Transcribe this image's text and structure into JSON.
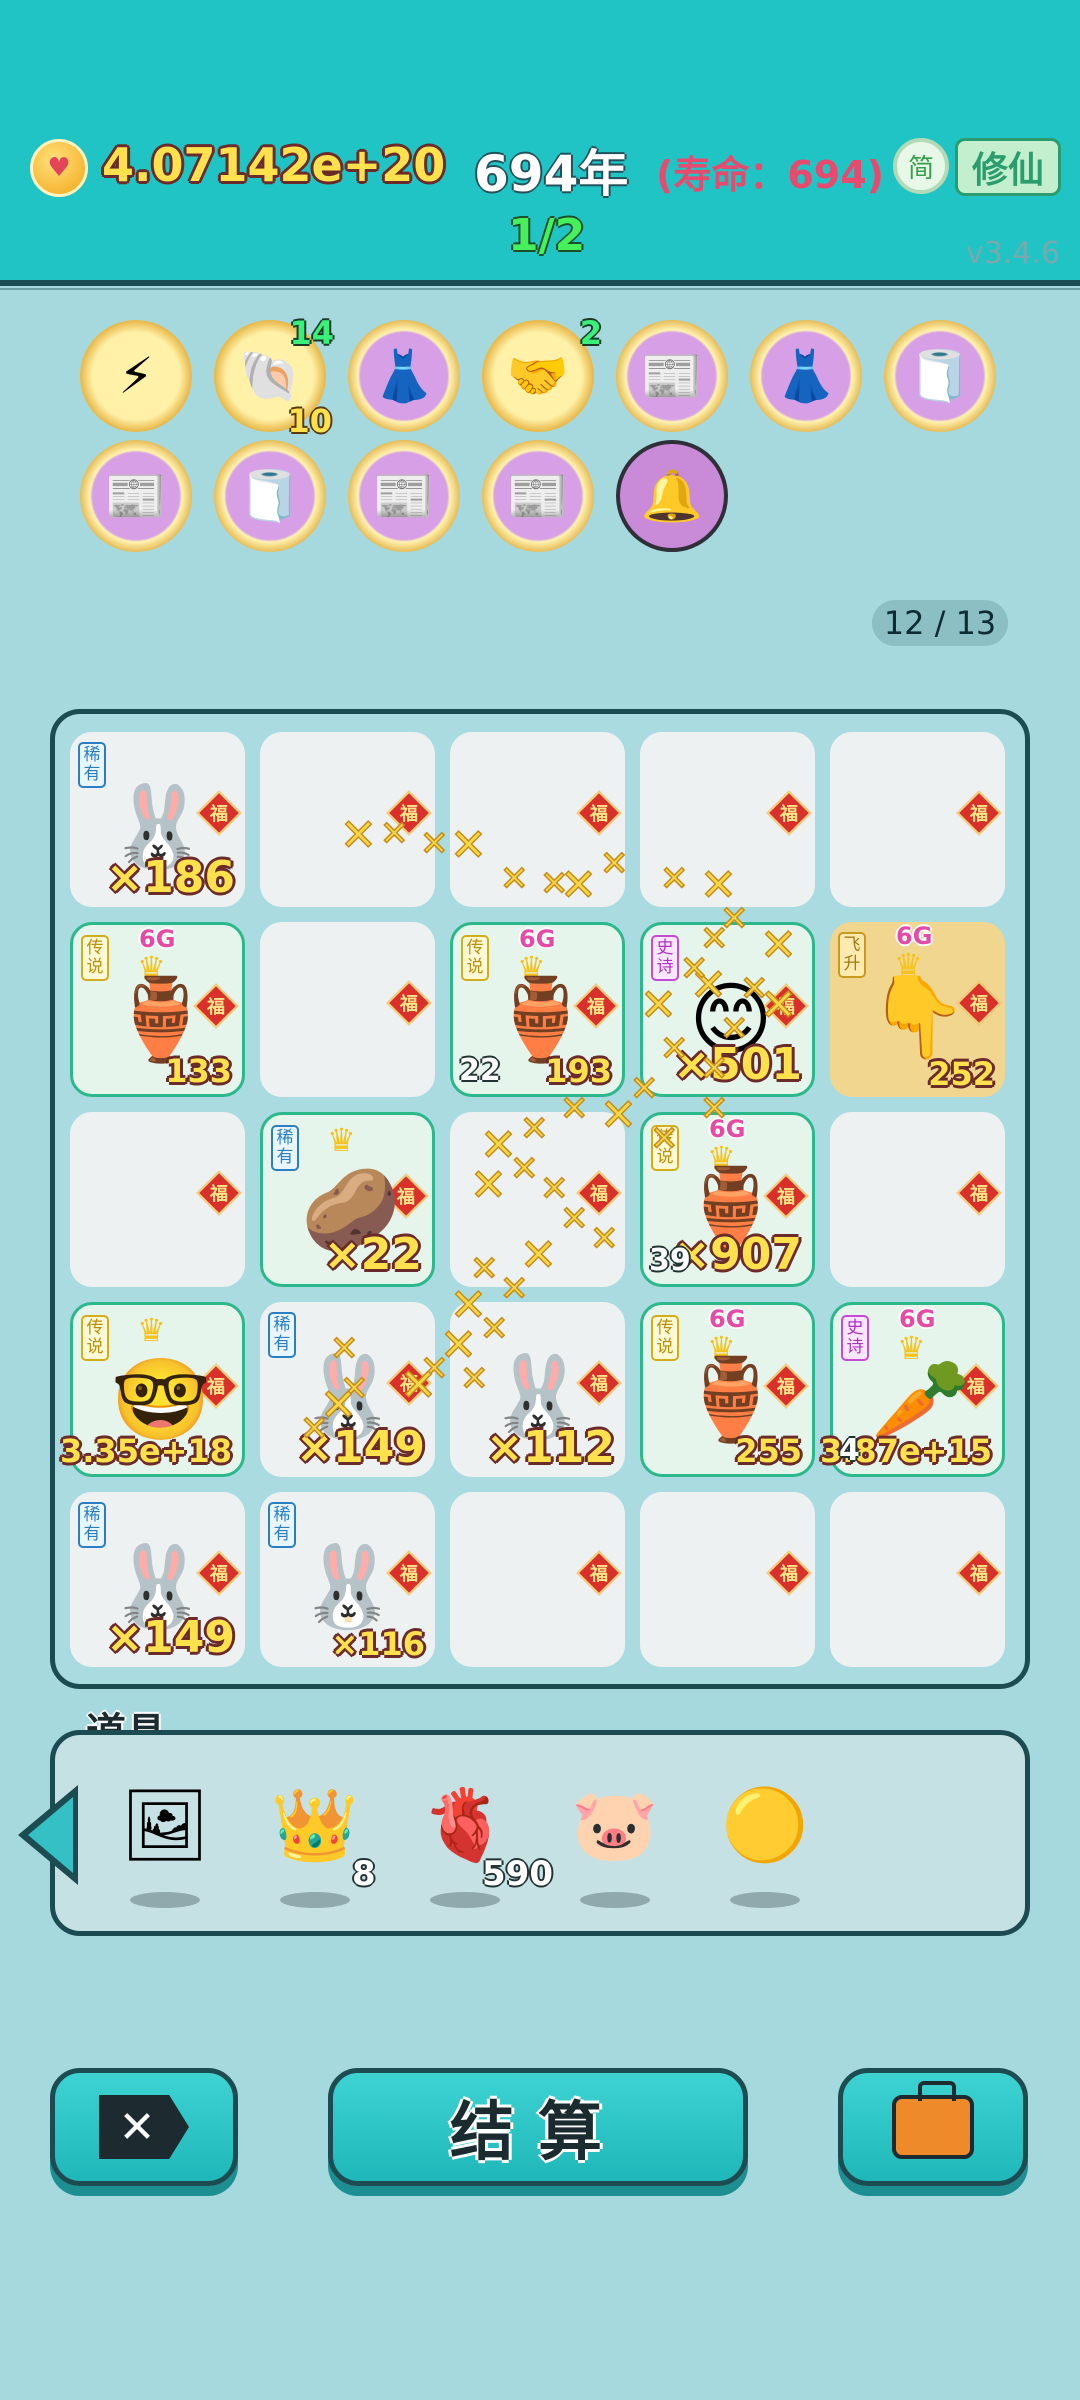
{
  "header": {
    "coins": "4.07142e+20",
    "year": "694年",
    "lifespan": "(寿命：694)",
    "round": "1/2",
    "lang_button": "简",
    "mode_button": "修仙",
    "version": "v3.4.6"
  },
  "relics": [
    {
      "icon": "lightning-icon",
      "glyph": "⚡",
      "style": "gold",
      "badge": ""
    },
    {
      "icon": "shell-icon",
      "glyph": "🐚",
      "style": "gold",
      "badge": "14",
      "badge2": "10"
    },
    {
      "icon": "skirt-icon",
      "glyph": "👗",
      "style": "pink",
      "badge": ""
    },
    {
      "icon": "handshake-icon",
      "glyph": "🤝",
      "style": "gold",
      "badge": "2"
    },
    {
      "icon": "time-magazine-icon",
      "glyph": "📰",
      "style": "pink",
      "badge": ""
    },
    {
      "icon": "skirt-icon",
      "glyph": "👗",
      "style": "pink",
      "badge": ""
    },
    {
      "icon": "tissue-box-icon",
      "glyph": "🧻",
      "style": "pink",
      "badge": ""
    },
    {
      "icon": "time-magazine-icon",
      "glyph": "📰",
      "style": "pink",
      "badge": ""
    },
    {
      "icon": "tissue-box-icon",
      "glyph": "🧻",
      "style": "pink",
      "badge": ""
    },
    {
      "icon": "time-magazine-icon",
      "glyph": "📰",
      "style": "pink",
      "badge": ""
    },
    {
      "icon": "time-magazine-icon",
      "glyph": "📰",
      "style": "pink",
      "badge": ""
    },
    {
      "icon": "alarm-icon",
      "glyph": "🔔",
      "style": "purple",
      "badge": ""
    }
  ],
  "relic_count": "12 / 13",
  "board": {
    "fu_char": "福",
    "cells": [
      {
        "rarity": "稀有",
        "rtype": "rare",
        "char": "🐰",
        "mult": "×186",
        "left": "",
        "bg": "plain"
      },
      {
        "rarity": "",
        "rtype": "",
        "char": "",
        "mult": "",
        "left": "",
        "bg": "plain"
      },
      {
        "rarity": "",
        "rtype": "",
        "char": "",
        "mult": "",
        "left": "",
        "bg": "plain"
      },
      {
        "rarity": "",
        "rtype": "",
        "char": "",
        "mult": "",
        "left": "",
        "bg": "plain"
      },
      {
        "rarity": "",
        "rtype": "",
        "char": "",
        "mult": "",
        "left": "",
        "bg": "plain"
      },
      {
        "rarity": "传说",
        "rtype": "leg",
        "char": "🏺",
        "mult": "133",
        "left": "",
        "bg": "glow",
        "sixg": true
      },
      {
        "rarity": "",
        "rtype": "",
        "char": "",
        "mult": "",
        "left": "",
        "bg": "plain"
      },
      {
        "rarity": "传说",
        "rtype": "leg",
        "char": "🏺",
        "mult": "193",
        "left": "22",
        "bg": "glow",
        "sixg": true
      },
      {
        "rarity": "史诗",
        "rtype": "epic",
        "char": "😊",
        "mult": "×501",
        "left": "",
        "bg": "glow",
        "sixg": false
      },
      {
        "rarity": "飞升",
        "rtype": "fly",
        "char": "👇",
        "mult": "252",
        "left": "",
        "bg": "gold",
        "sixg": true
      },
      {
        "rarity": "",
        "rtype": "",
        "char": "",
        "mult": "",
        "left": "",
        "bg": "plain"
      },
      {
        "rarity": "稀有",
        "rtype": "rare",
        "char": "🥔",
        "mult": "×22",
        "left": "",
        "bg": "glow",
        "crown": true
      },
      {
        "rarity": "",
        "rtype": "",
        "char": "",
        "mult": "",
        "left": "",
        "bg": "plain"
      },
      {
        "rarity": "传说",
        "rtype": "leg",
        "char": "🏺",
        "mult": "×907",
        "left": "39",
        "bg": "glow",
        "sixg": true
      },
      {
        "rarity": "",
        "rtype": "",
        "char": "",
        "mult": "",
        "left": "",
        "bg": "plain"
      },
      {
        "rarity": "传说",
        "rtype": "leg",
        "char": "🤓",
        "mult": "3.35e+18",
        "left": "",
        "bg": "glow",
        "crown": true
      },
      {
        "rarity": "稀有",
        "rtype": "rare",
        "char": "🐰",
        "mult": "×149",
        "left": "",
        "bg": "plain"
      },
      {
        "rarity": "",
        "rtype": "",
        "char": "🐰",
        "mult": "×112",
        "left": "",
        "bg": "plain"
      },
      {
        "rarity": "传说",
        "rtype": "leg",
        "char": "🏺",
        "mult": "255",
        "left": "",
        "bg": "glow",
        "sixg": true
      },
      {
        "rarity": "史诗",
        "rtype": "epic",
        "char": "🥕",
        "mult": "3.87e+15",
        "left": "4",
        "bg": "glow",
        "sixg": true
      },
      {
        "rarity": "稀有",
        "rtype": "rare",
        "char": "🐰",
        "mult": "×149",
        "left": "",
        "bg": "plain"
      },
      {
        "rarity": "稀有",
        "rtype": "rare",
        "char": "🐰",
        "mult": "×116",
        "left": "",
        "bg": "plain"
      },
      {
        "rarity": "",
        "rtype": "",
        "char": "",
        "mult": "",
        "left": "",
        "bg": "plain"
      },
      {
        "rarity": "",
        "rtype": "",
        "char": "",
        "mult": "",
        "left": "",
        "bg": "plain"
      },
      {
        "rarity": "",
        "rtype": "",
        "char": "",
        "mult": "",
        "left": "",
        "bg": "plain"
      }
    ]
  },
  "items": {
    "title": "道具",
    "list": [
      {
        "icon": "picture-frame-icon",
        "glyph": "🖼",
        "count": ""
      },
      {
        "icon": "crown-icon",
        "glyph": "👑",
        "count": "8"
      },
      {
        "icon": "liver-icon",
        "glyph": "🫀",
        "count": "590"
      },
      {
        "icon": "piggy-bank-icon",
        "glyph": "🐷",
        "count": ""
      },
      {
        "icon": "gold-ball-icon",
        "glyph": "🟡",
        "count": ""
      }
    ]
  },
  "buttons": {
    "exit_label": "✕",
    "settle_label": "结算",
    "bag_icon": "briefcase-icon"
  },
  "six_g": "6G"
}
